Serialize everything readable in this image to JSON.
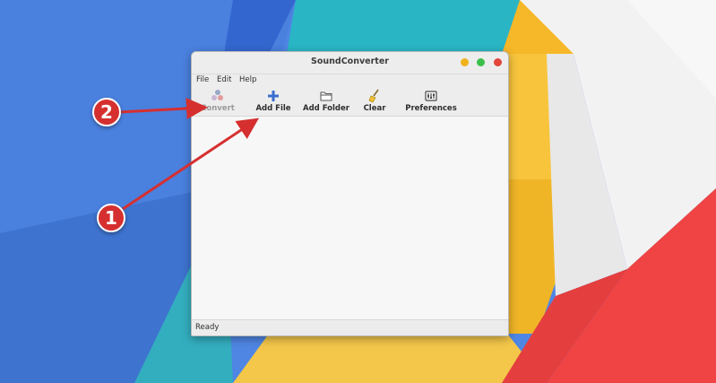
{
  "window": {
    "title": "SoundConverter"
  },
  "menu": [
    "File",
    "Edit",
    "Help"
  ],
  "toolbar": {
    "convert": "Convert",
    "add_file": "Add File",
    "add_folder": "Add Folder",
    "clear": "Clear",
    "preferences": "Preferences"
  },
  "status": {
    "text": "Ready"
  },
  "annotations": {
    "first": "1",
    "second": "2"
  },
  "colors": {
    "window_min": "#f0b21b",
    "window_max": "#3bbf4a",
    "window_close": "#e3463b",
    "annotation": "#d62f2f"
  },
  "icons": {
    "convert": "convert-icon",
    "add_file": "plus-icon",
    "add_folder": "folder-icon",
    "clear": "broom-icon",
    "preferences": "preferences-icon"
  }
}
